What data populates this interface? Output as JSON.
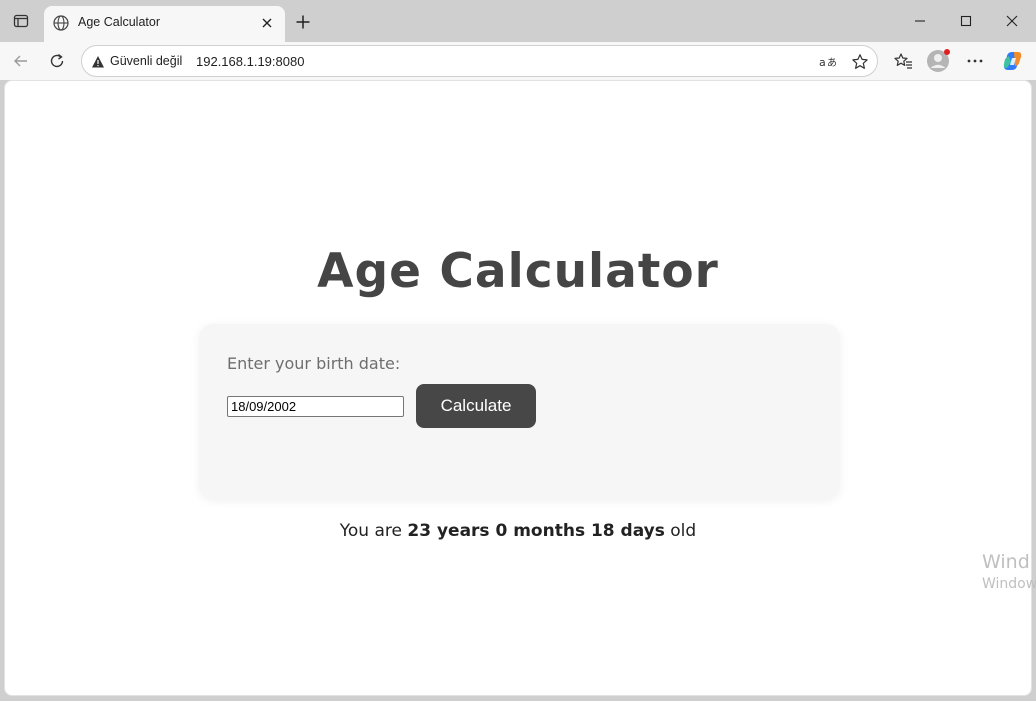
{
  "browser": {
    "tab": {
      "title": "Age Calculator"
    },
    "address": {
      "security_label": "Güvenli değil",
      "url": "192.168.1.19:8080"
    },
    "icons": {
      "tab_actions": "tab-actions-icon",
      "favicon": "globe-icon",
      "tab_close": "close-icon",
      "new_tab": "plus-icon",
      "minimize": "minimize-icon",
      "maximize": "maximize-icon",
      "close_window": "close-icon",
      "back": "arrow-left-icon",
      "refresh": "refresh-icon",
      "warning": "warning-icon",
      "read_aloud": "read-aloud-icon",
      "favorite": "star-icon",
      "favorites": "favorites-icon",
      "profile": "avatar-icon",
      "more": "more-icon",
      "copilot": "copilot-icon"
    }
  },
  "page": {
    "title": "Age Calculator",
    "form": {
      "label": "Enter your birth date:",
      "date_value": "18/09/2002",
      "button_label": "Calculate"
    },
    "result": {
      "prefix": "You are",
      "value": "23 years 0 months 18 days",
      "suffix": "old"
    }
  },
  "watermark": {
    "line1": "Wind",
    "line2": "Window"
  },
  "colors": {
    "accent_button": "#474747",
    "title_text": "#454545",
    "card_bg": "#f6f6f6",
    "copilot_accent": "#2f7cf6",
    "notification_dot": "#e02020"
  }
}
